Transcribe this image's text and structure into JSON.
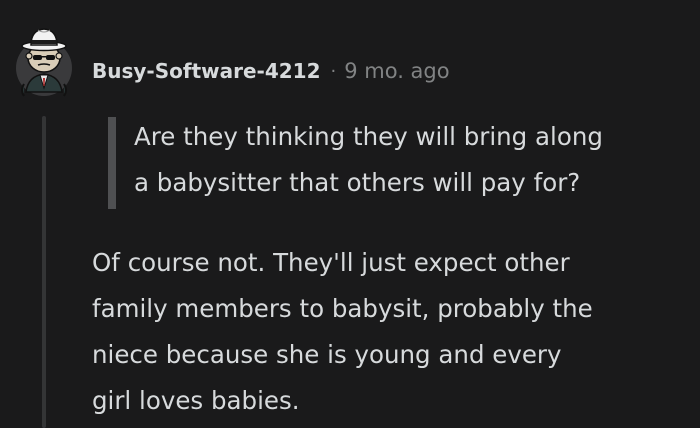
{
  "comment": {
    "username": "Busy-Software-4212",
    "separator": "·",
    "timestamp": "9 mo. ago",
    "quote_lines": [
      "Are they thinking they will bring along",
      "a babysitter that others will pay for?"
    ],
    "body_lines": [
      "Of course not. They'll just expect other",
      "family members to babysit, probably the",
      "niece because she is young and every",
      "girl loves babies."
    ]
  },
  "colors": {
    "background": "#1a1a1b",
    "text": "#d7dadc",
    "muted": "#818384",
    "thread_line": "#343536",
    "quote_bar": "#4f5052"
  },
  "avatar": {
    "icon": "gangster-snoo-avatar-icon"
  }
}
